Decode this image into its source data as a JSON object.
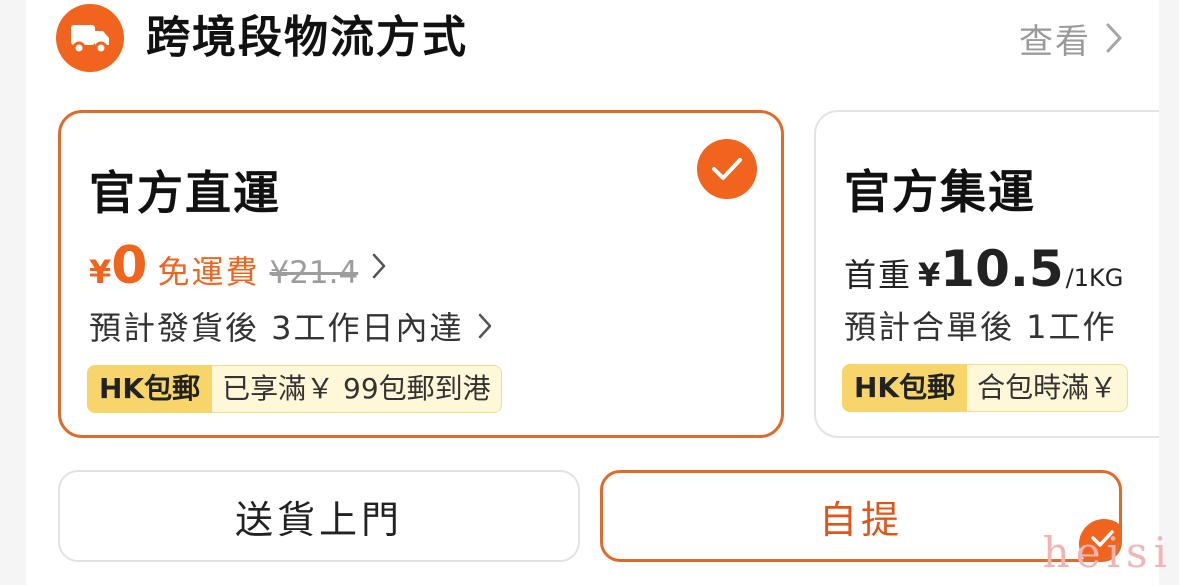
{
  "header": {
    "title": "跨境段物流方式",
    "view_label": "查看",
    "logo_icon": "truck-icon"
  },
  "options": [
    {
      "name": "官方直運",
      "selected": true,
      "currency": "¥",
      "price": "0",
      "free_label": "免運費",
      "original_price": "¥21.4",
      "eta": "預計發貨後 3工作日內達",
      "tag_label": "HK包郵",
      "tag_text": "已享滿￥ 99包郵到港"
    },
    {
      "name": "官方集運",
      "selected": false,
      "price_prefix": "首重",
      "currency": "¥",
      "price": "10.5",
      "unit": "/1KG",
      "eta": "預計合單後 1工作",
      "tag_label": "HK包郵",
      "tag_text": "合包時滿￥"
    }
  ],
  "delivery_buttons": {
    "home_delivery": "送貨上門",
    "self_pickup": "自提",
    "selected": "self_pickup"
  },
  "watermark": "heisi",
  "colors": {
    "accent": "#f0641e",
    "tag_bg": "#f7d56a",
    "tag_text_bg": "#fff8d8",
    "muted": "#9a9a9a"
  }
}
